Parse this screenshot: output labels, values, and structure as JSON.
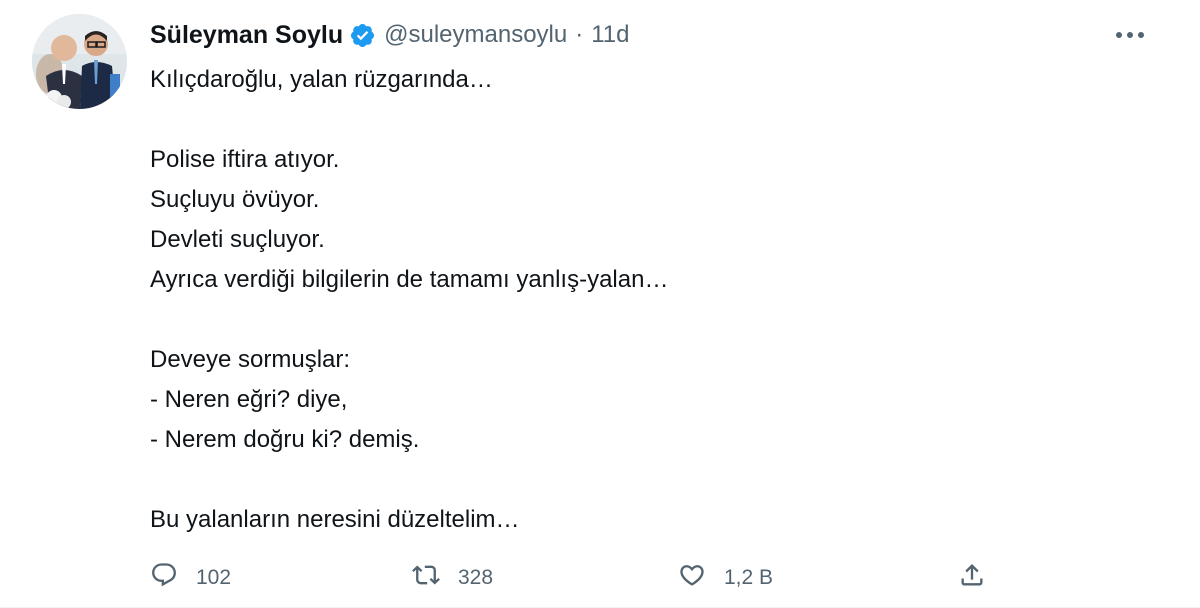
{
  "author": {
    "display_name": "Süleyman Soylu",
    "handle": "@suleymansoylu",
    "separator": "·",
    "time": "11d",
    "verified_icon": "verified-badge-icon",
    "verified_color": "#1d9bf0",
    "avatar_icon": "profile-photo"
  },
  "tweet": {
    "lines": [
      "Kılıçdaroğlu, yalan rüzgarında…",
      "",
      "Polise iftira atıyor.",
      "Suçluyu övüyor.",
      "Devleti suçluyor.",
      "Ayrıca verdiği bilgilerin de tamamı yanlış-yalan…",
      "",
      "Deveye sormuşlar:",
      "- Neren eğri? diye,",
      "- Nerem doğru ki? demiş.",
      "",
      "Bu yalanların neresini düzeltelim…"
    ]
  },
  "actions": {
    "reply": {
      "icon": "reply-icon",
      "count": "102"
    },
    "retweet": {
      "icon": "retweet-icon",
      "count": "328"
    },
    "like": {
      "icon": "like-icon",
      "count": "1,2 B"
    },
    "share": {
      "icon": "share-icon"
    }
  },
  "more_icon": "more-options-icon",
  "colors": {
    "text": "#0f1419",
    "secondary": "#536471",
    "accent": "#1d9bf0"
  }
}
